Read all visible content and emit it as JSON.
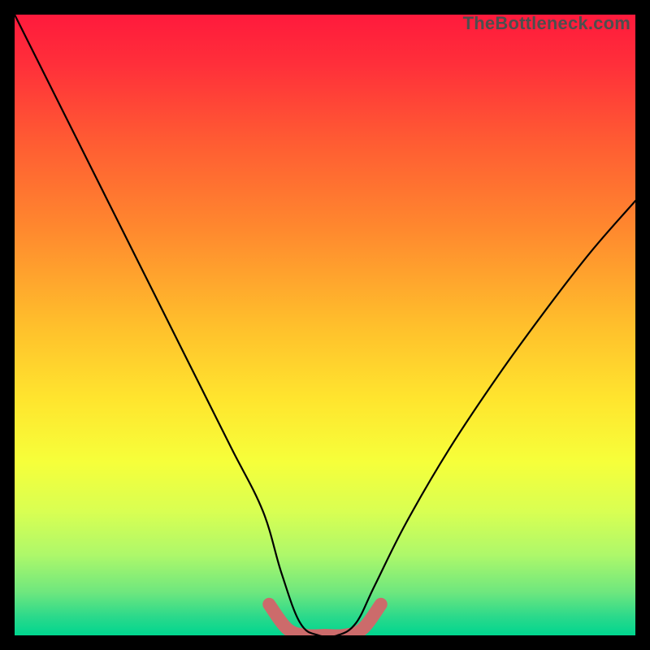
{
  "watermark": "TheBottleneck.com",
  "chart_data": {
    "type": "line",
    "title": "",
    "xlabel": "",
    "ylabel": "",
    "xlim": [
      0,
      100
    ],
    "ylim": [
      0,
      100
    ],
    "series": [
      {
        "name": "curve",
        "x": [
          0,
          5,
          10,
          15,
          20,
          25,
          30,
          35,
          40,
          43,
          46,
          49,
          52,
          55,
          58,
          63,
          70,
          78,
          86,
          93,
          100
        ],
        "y": [
          100,
          90,
          80,
          70,
          60,
          50,
          40,
          30,
          20,
          10,
          2,
          0,
          0,
          2,
          8,
          18,
          30,
          42,
          53,
          62,
          70
        ]
      },
      {
        "name": "floor-highlight",
        "x": [
          41,
          44,
          47,
          50,
          53,
          56,
          59
        ],
        "y": [
          5,
          1,
          0,
          0,
          0,
          1,
          5
        ]
      }
    ],
    "gradient_stops": [
      {
        "offset": 0.0,
        "color": "#ff1a3c"
      },
      {
        "offset": 0.08,
        "color": "#ff2f3a"
      },
      {
        "offset": 0.2,
        "color": "#ff5a33"
      },
      {
        "offset": 0.35,
        "color": "#ff8a2e"
      },
      {
        "offset": 0.5,
        "color": "#ffbf2c"
      },
      {
        "offset": 0.62,
        "color": "#ffe52e"
      },
      {
        "offset": 0.72,
        "color": "#f6ff3a"
      },
      {
        "offset": 0.8,
        "color": "#d9ff52"
      },
      {
        "offset": 0.87,
        "color": "#aef86a"
      },
      {
        "offset": 0.93,
        "color": "#6fe77e"
      },
      {
        "offset": 0.97,
        "color": "#2bd98b"
      },
      {
        "offset": 1.0,
        "color": "#00d68f"
      }
    ],
    "highlight_color": "#cc6b6b",
    "curve_color": "#000000"
  }
}
